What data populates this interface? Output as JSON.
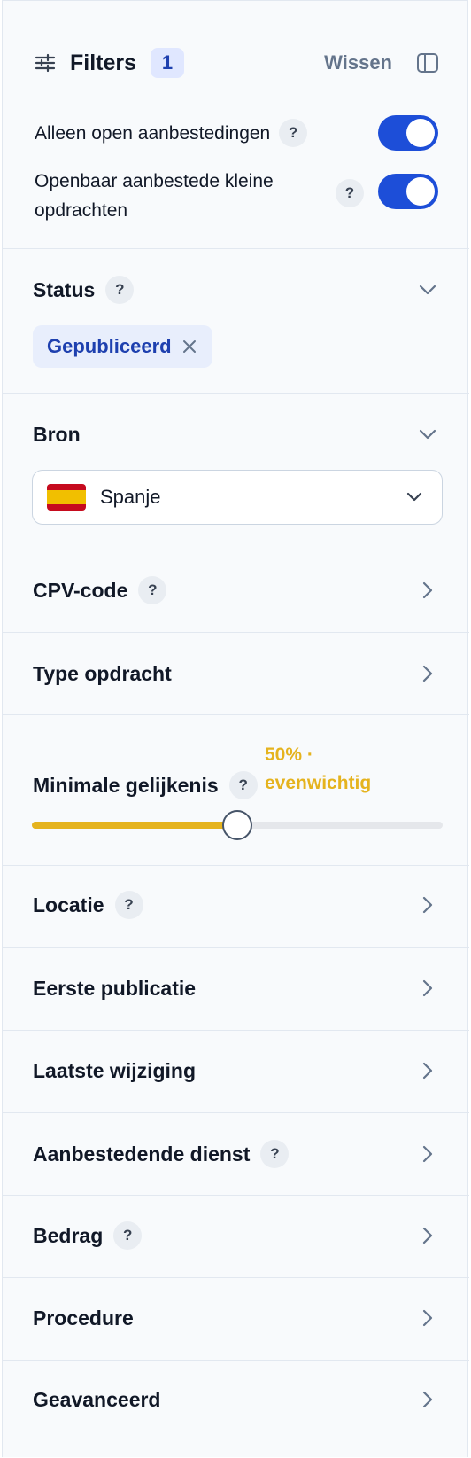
{
  "header": {
    "title": "Filters",
    "active_count": "1",
    "clear_label": "Wissen",
    "toggles": [
      {
        "label": "Alleen open aanbestedingen",
        "help": "?",
        "on": true
      },
      {
        "label": "Openbaar aanbestede kleine opdrachten",
        "help": "?",
        "on": true
      }
    ]
  },
  "sections": {
    "status": {
      "title": "Status",
      "help": "?",
      "chip": "Gepubliceerd"
    },
    "bron": {
      "title": "Bron",
      "selected": "Spanje"
    },
    "cpv": {
      "title": "CPV-code",
      "help": "?"
    },
    "type": {
      "title": "Type opdracht"
    },
    "similarity": {
      "title": "Minimale gelijkenis",
      "help": "?",
      "value_label": "50% · evenwichtig",
      "value": 0.5
    },
    "locatie": {
      "title": "Locatie",
      "help": "?"
    },
    "eerste": {
      "title": "Eerste publicatie"
    },
    "laatste": {
      "title": "Laatste wijziging"
    },
    "dienst": {
      "title": "Aanbestedende dienst",
      "help": "?"
    },
    "bedrag": {
      "title": "Bedrag",
      "help": "?"
    },
    "procedure": {
      "title": "Procedure"
    },
    "geavanceerd": {
      "title": "Geavanceerd"
    }
  },
  "colors": {
    "accent_blue": "#1d4ed8",
    "chip_text": "#1e40af",
    "slider_yellow": "#e5b31e"
  },
  "icons": {
    "filters": "sliders-icon",
    "sidebar": "panel-toggle-icon",
    "chevron_down": "chevron-down-icon",
    "chevron_right": "chevron-right-icon",
    "close": "close-icon",
    "flag": "spain-flag-icon"
  }
}
